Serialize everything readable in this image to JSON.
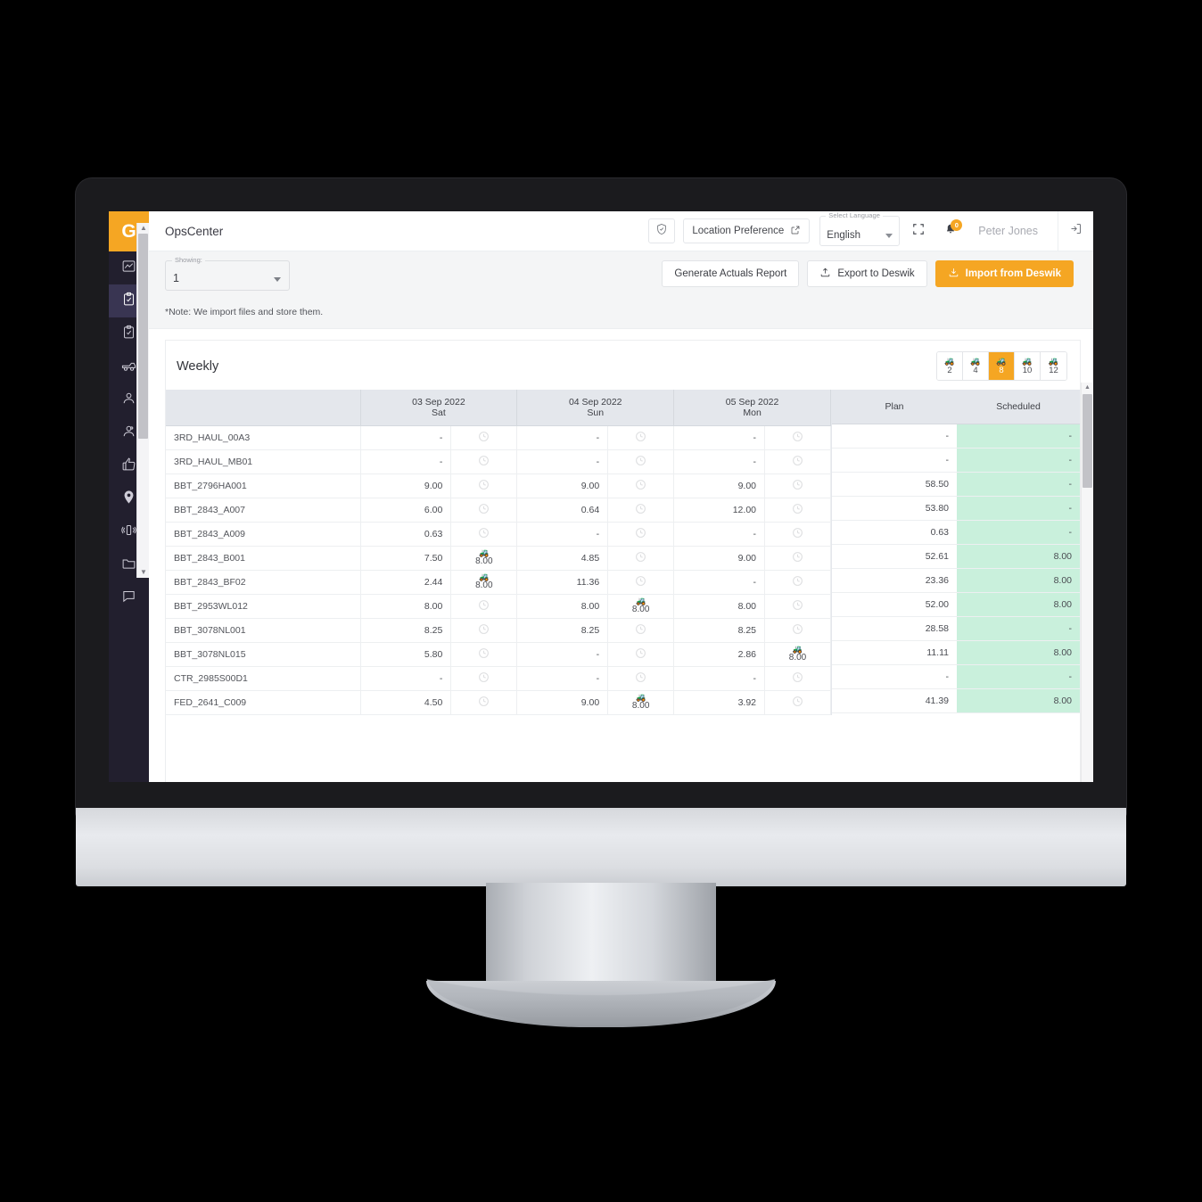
{
  "app": {
    "title": "OpsCenter",
    "logo_letter": "G"
  },
  "topbar": {
    "shield_icon": "shield-icon",
    "location_preference": "Location Preference",
    "external_link_icon": "external-link-icon",
    "language_label": "Select Language",
    "language_value": "English",
    "fullscreen_icon": "fullscreen-icon",
    "bell_icon": "bell-icon",
    "notification_count": "0",
    "user_name": "Peter Jones",
    "signout_icon": "sign-out-icon"
  },
  "sidebar": {
    "items": [
      {
        "name": "analytics",
        "icon": "chart-icon",
        "active": false
      },
      {
        "name": "shift-log",
        "icon": "clipboard-check-icon",
        "active": true
      },
      {
        "name": "tasks",
        "icon": "clipboard-icon",
        "active": false
      },
      {
        "name": "equipment",
        "icon": "truck-icon",
        "active": false
      },
      {
        "name": "operators",
        "icon": "person-icon",
        "active": false
      },
      {
        "name": "crew",
        "icon": "person-badge-icon",
        "active": false
      },
      {
        "name": "approvals",
        "icon": "thumbs-up-icon",
        "active": false
      },
      {
        "name": "locations",
        "icon": "map-pin-icon",
        "active": false
      },
      {
        "name": "devices",
        "icon": "device-icon",
        "active": false
      },
      {
        "name": "files",
        "icon": "folder-icon",
        "active": false
      },
      {
        "name": "messages",
        "icon": "chat-icon",
        "active": false
      }
    ]
  },
  "toolbar": {
    "showing_label": "Showing:",
    "showing_value": "1",
    "generate_report": "Generate Actuals Report",
    "export": "Export to Deswik",
    "import": "Import from Deswik",
    "export_icon": "upload-icon",
    "import_icon": "download-icon",
    "note": "*Note: We import files and store them."
  },
  "panel": {
    "title": "Weekly",
    "ranges": [
      {
        "label": "2",
        "active": false
      },
      {
        "label": "4",
        "active": false
      },
      {
        "label": "8",
        "active": true
      },
      {
        "label": "10",
        "active": false
      },
      {
        "label": "12",
        "active": false
      }
    ]
  },
  "table": {
    "day_columns": [
      {
        "date": "03 Sep 2022",
        "day": "Sat"
      },
      {
        "date": "04 Sep 2022",
        "day": "Sun"
      },
      {
        "date": "05 Sep 2022",
        "day": "Mon"
      }
    ],
    "summary_columns": [
      "Plan",
      "Scheduled"
    ],
    "rows": [
      {
        "name": "3RD_HAUL_00A3",
        "d0": "-",
        "a0": "",
        "d1": "-",
        "a1": "",
        "d2": "-",
        "a2": "",
        "plan": "-",
        "scheduled": "-"
      },
      {
        "name": "3RD_HAUL_MB01",
        "d0": "-",
        "a0": "",
        "d1": "-",
        "a1": "",
        "d2": "-",
        "a2": "",
        "plan": "-",
        "scheduled": "-"
      },
      {
        "name": "BBT_2796HA001",
        "d0": "9.00",
        "a0": "",
        "d1": "9.00",
        "a1": "",
        "d2": "9.00",
        "a2": "",
        "plan": "58.50",
        "scheduled": "-"
      },
      {
        "name": "BBT_2843_A007",
        "d0": "6.00",
        "a0": "",
        "d1": "0.64",
        "a1": "",
        "d2": "12.00",
        "a2": "",
        "plan": "53.80",
        "scheduled": "-"
      },
      {
        "name": "BBT_2843_A009",
        "d0": "0.63",
        "a0": "",
        "d1": "-",
        "a1": "",
        "d2": "-",
        "a2": "",
        "plan": "0.63",
        "scheduled": "-"
      },
      {
        "name": "BBT_2843_B001",
        "d0": "7.50",
        "a0": "8.00",
        "d1": "4.85",
        "a1": "",
        "d2": "9.00",
        "a2": "",
        "plan": "52.61",
        "scheduled": "8.00"
      },
      {
        "name": "BBT_2843_BF02",
        "d0": "2.44",
        "a0": "8.00",
        "d1": "11.36",
        "a1": "",
        "d2": "-",
        "a2": "",
        "plan": "23.36",
        "scheduled": "8.00"
      },
      {
        "name": "BBT_2953WL012",
        "d0": "8.00",
        "a0": "",
        "d1": "8.00",
        "a1": "8.00",
        "d2": "8.00",
        "a2": "",
        "plan": "52.00",
        "scheduled": "8.00"
      },
      {
        "name": "BBT_3078NL001",
        "d0": "8.25",
        "a0": "",
        "d1": "8.25",
        "a1": "",
        "d2": "8.25",
        "a2": "",
        "plan": "28.58",
        "scheduled": "-"
      },
      {
        "name": "BBT_3078NL015",
        "d0": "5.80",
        "a0": "",
        "d1": "-",
        "a1": "",
        "d2": "2.86",
        "a2": "8.00",
        "plan": "11.11",
        "scheduled": "8.00"
      },
      {
        "name": "CTR_2985S00D1",
        "d0": "-",
        "a0": "",
        "d1": "-",
        "a1": "",
        "d2": "-",
        "a2": "",
        "plan": "-",
        "scheduled": "-"
      },
      {
        "name": "FED_2641_C009",
        "d0": "4.50",
        "a0": "",
        "d1": "9.00",
        "a1": "8.00",
        "d2": "3.92",
        "a2": "",
        "plan": "41.39",
        "scheduled": "8.00"
      }
    ]
  },
  "colors": {
    "accent": "#f5a623",
    "sidebar": "#221f2e",
    "scheduled_cell": "#c9f0dc",
    "header_row": "#e4e7ec"
  }
}
